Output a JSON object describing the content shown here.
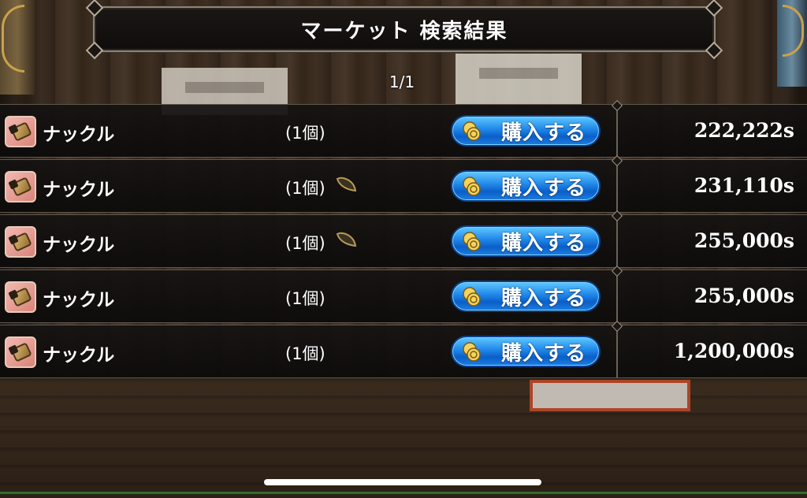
{
  "header": {
    "title": "マーケット 検索結果"
  },
  "pagination": {
    "label": "1/1"
  },
  "buy_label": "購入する",
  "listings": [
    {
      "name": "ナックル",
      "quantity": "(1個)",
      "has_seed": false,
      "price": "222,222s"
    },
    {
      "name": "ナックル",
      "quantity": "(1個)",
      "has_seed": true,
      "price": "231,110s"
    },
    {
      "name": "ナックル",
      "quantity": "(1個)",
      "has_seed": true,
      "price": "255,000s"
    },
    {
      "name": "ナックル",
      "quantity": "(1個)",
      "has_seed": false,
      "price": "255,000s"
    },
    {
      "name": "ナックル",
      "quantity": "(1個)",
      "has_seed": false,
      "price": "1,200,000s"
    }
  ],
  "icons": {
    "item": "knuckle-item-icon",
    "buy": "coin-icon",
    "seed": "seed-icon"
  },
  "colors": {
    "buy_button": "#1f86e8",
    "panel": "#141211",
    "border": "#8f8474"
  }
}
